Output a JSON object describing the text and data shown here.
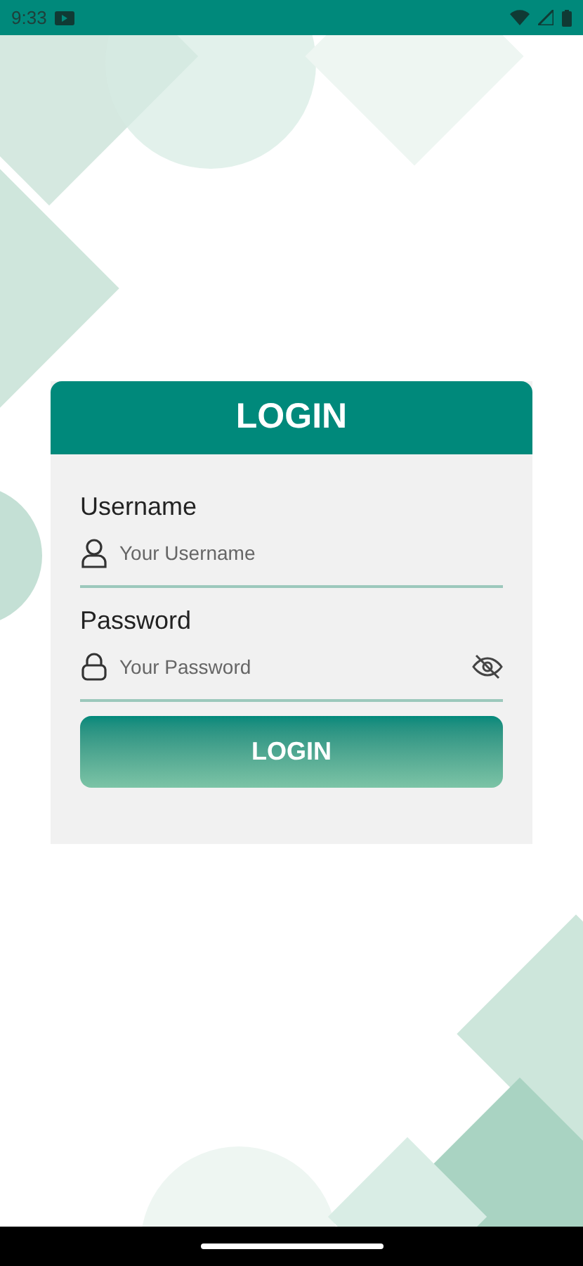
{
  "status_bar": {
    "time": "9:33"
  },
  "card": {
    "title": "LOGIN",
    "fields": [
      {
        "kind": "user",
        "label": "Username",
        "placeholder": "Your Username"
      },
      {
        "kind": "password",
        "label": "Password",
        "placeholder": "Your Password"
      }
    ],
    "button": "LOGIN"
  }
}
